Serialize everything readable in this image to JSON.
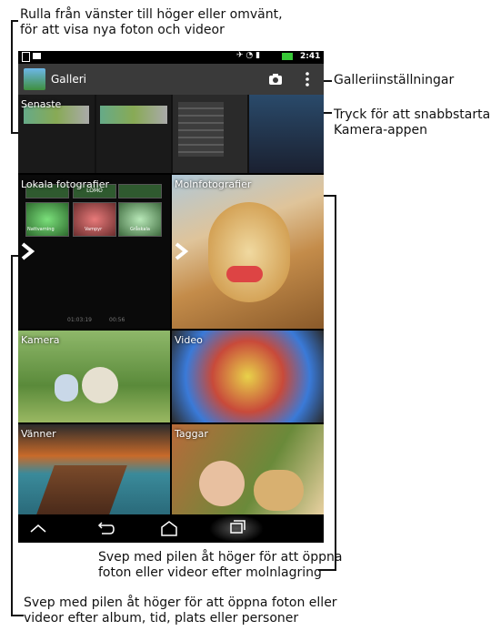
{
  "annotations": {
    "top_left": "Rulla från vänster till höger eller omvänt,\nför att visa nya foton och videor",
    "settings": "Galleriinställningar",
    "camera": "Tryck för att snabbstarta\nKamera-appen",
    "cloud": "Svep med pilen åt höger för att öppna\nfoton eller videor efter molnlagring",
    "local": "Svep med pilen åt höger för att öppna foton eller\nvideor efter album, tid, plats eller personer"
  },
  "status": {
    "time": "2:41"
  },
  "actionbar": {
    "title": "Galleri"
  },
  "tiles": {
    "recent": "Senaste",
    "local": "Lokala fotografier",
    "cloud": "Molnfotografier",
    "camera": "Kamera",
    "video": "Video",
    "friends": "Vänner",
    "tags": "Taggar"
  },
  "local_thumbs": {
    "t1": "LOMO",
    "t2": "Nattvarning",
    "t3": "Vampyr",
    "t4": "Gråskala",
    "time_a": "01:03:19",
    "time_b": "00:56"
  },
  "icons": {
    "app": "gallery-icon",
    "camera": "camera-icon",
    "menu": "overflow-menu-icon",
    "back": "back-icon",
    "home": "home-icon",
    "recents": "recent-apps-icon",
    "up": "hide-nav-icon",
    "arrow": "chevron-right-icon"
  }
}
